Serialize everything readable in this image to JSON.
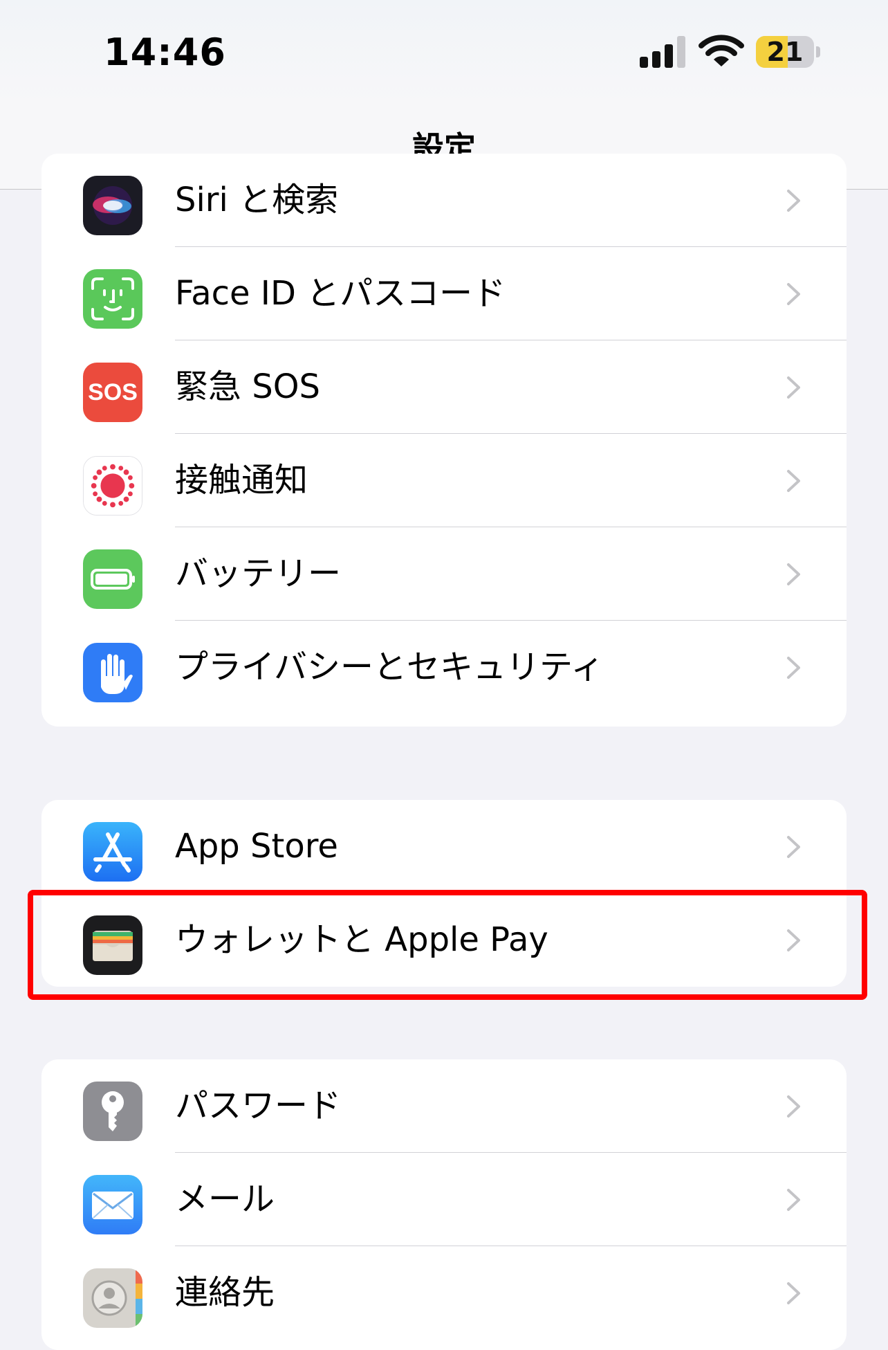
{
  "status_bar": {
    "time": "14:46",
    "battery_level": "21",
    "battery_fraction": 0.21
  },
  "nav": {
    "title": "設定"
  },
  "groups": [
    {
      "rows": [
        {
          "label": "Siri と検索",
          "icon": "siri-icon"
        },
        {
          "label": "Face ID とパスコード",
          "icon": "face-id-icon"
        },
        {
          "label": "緊急 SOS",
          "icon": "sos-icon",
          "icon_text": "SOS"
        },
        {
          "label": "接触通知",
          "icon": "exposure-notification-icon"
        },
        {
          "label": "バッテリー",
          "icon": "battery-icon"
        },
        {
          "label": "プライバシーとセキュリティ",
          "icon": "hand-icon"
        }
      ]
    },
    {
      "rows": [
        {
          "label": "App Store",
          "icon": "app-store-icon"
        },
        {
          "label": "ウォレットと Apple Pay",
          "icon": "wallet-icon"
        }
      ]
    },
    {
      "rows": [
        {
          "label": "パスワード",
          "icon": "key-icon"
        },
        {
          "label": "メール",
          "icon": "mail-icon"
        },
        {
          "label": "連絡先",
          "icon": "contacts-icon"
        }
      ]
    }
  ],
  "colors": {
    "background": "#f2f2f7",
    "highlight_border": "#ff0000",
    "chevron": "#c4c4c7",
    "face_id": "#5ac85a",
    "sos": "#eb4b3d",
    "battery_app": "#5cc85c",
    "privacy": "#2f7cf6",
    "app_store": "#1e8cf5",
    "mail": "#2f8df6",
    "passwords": "#8e8e93"
  }
}
